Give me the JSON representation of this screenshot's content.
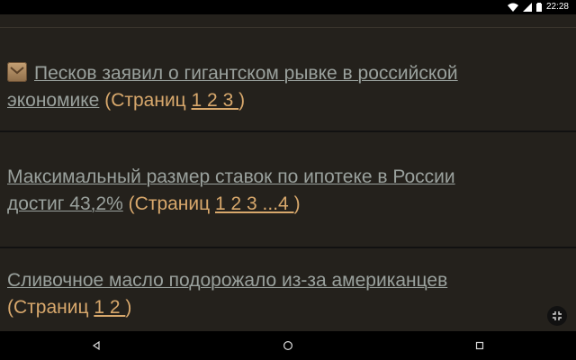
{
  "status_bar": {
    "time": "22:28",
    "icons": [
      "wifi-icon",
      "signal-icon",
      "battery-icon"
    ]
  },
  "topics": [
    {
      "title_line1": "Песков заявил о гигантском рывке в российской",
      "title_line2": "экономике",
      "pages_prefix": " (Страниц ",
      "pages": "1 2 3 ",
      "pages_suffix": ")",
      "has_icon": true
    },
    {
      "title_line1": "Максимальный размер ставок по ипотеке в России",
      "title_line2": "достиг 43,2%",
      "pages_prefix": " (Страниц ",
      "pages": "1 2 3 ...4 ",
      "pages_suffix": ")"
    },
    {
      "title_line1": "Сливочное масло подорожало из-за американцев",
      "pages_prefix": "(Страниц ",
      "pages": "1 2 ",
      "pages_suffix": ")"
    }
  ],
  "colors": {
    "background": "#24211c",
    "link": "#9aa19d",
    "pages": "#d8a86c"
  }
}
